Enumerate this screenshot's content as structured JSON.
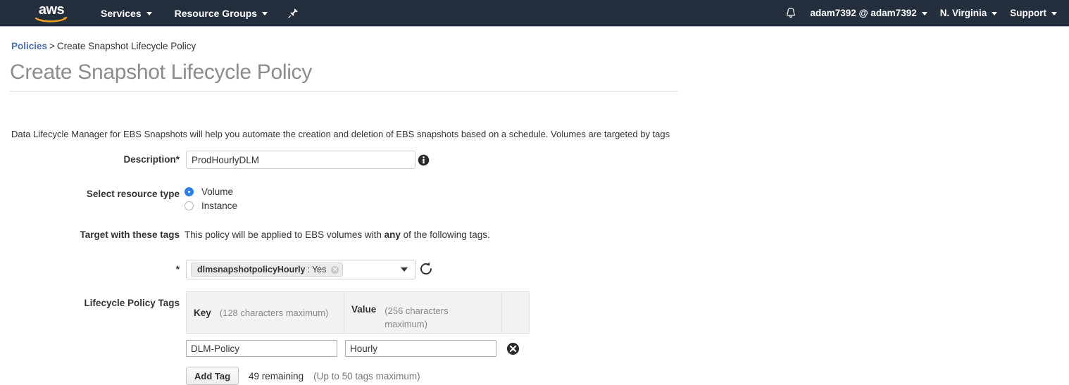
{
  "nav": {
    "logo_alt": "aws",
    "services": "Services",
    "resource_groups": "Resource Groups",
    "pin_icon": "pushpin-icon",
    "bell_icon": "bell-icon",
    "account": "adam7392 @ adam7392",
    "region": "N. Virginia",
    "support": "Support",
    "bg_color": "#242f3e",
    "logo_smile_color": "#f0a01e"
  },
  "breadcrumb": {
    "link": "Policies",
    "separator": ">",
    "current": "Create Snapshot Lifecycle Policy",
    "link_color": "#4a6fb5"
  },
  "page": {
    "title": "Create Snapshot Lifecycle Policy",
    "intro": "Data Lifecycle Manager for EBS Snapshots will help you automate the creation and deletion of EBS snapshots based on a schedule. Volumes are targeted by tags"
  },
  "form": {
    "description": {
      "label": "Description*",
      "value": "ProdHourlyDLM",
      "info_icon": "info-icon"
    },
    "resource_type": {
      "label": "Select resource type",
      "options": [
        {
          "label": "Volume",
          "selected": true
        },
        {
          "label": "Instance",
          "selected": false
        }
      ],
      "selected_color": "#2f7fe8"
    },
    "target_tags": {
      "label": "Target with these tags",
      "text_before": "This policy will be applied to EBS volumes with ",
      "emphasis": "any",
      "text_after": " of the following tags."
    },
    "tag_select": {
      "required_marker": "*",
      "chip_key": "dlmsnapshotpolicyHourly",
      "chip_separator": ":",
      "chip_value": "Yes",
      "chip_remove_icon": "close-icon",
      "caret_icon": "chevron-down-icon",
      "refresh_icon": "refresh-icon"
    },
    "lifecycle_tags": {
      "label": "Lifecycle Policy Tags",
      "columns": [
        {
          "title": "Key",
          "hint": "(128 characters maximum)"
        },
        {
          "title": "Value",
          "hint": "(256 characters maximum)"
        }
      ],
      "rows": [
        {
          "key": "DLM-Policy",
          "value": "Hourly",
          "remove_icon": "delete-icon"
        }
      ],
      "add_button": "Add Tag",
      "remaining": "49 remaining",
      "max_hint": "(Up to 50 tags maximum)"
    }
  }
}
